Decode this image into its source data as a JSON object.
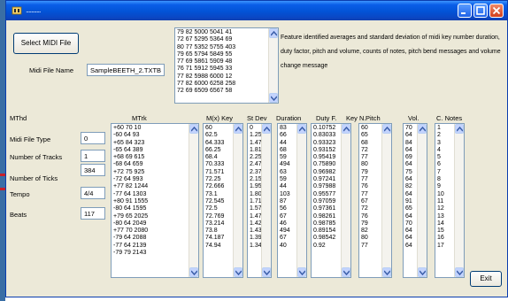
{
  "window": {
    "title": "...........",
    "accent": "#0253d6"
  },
  "buttons": {
    "select_midi": "Select MIDI File",
    "exit": "Exit"
  },
  "file_name": {
    "label": "Midi File Name",
    "value": "SampleBEETH_2.TXTB"
  },
  "preview_rows": [
    "79 82 5000 5041 41",
    "72 67 5295 5364 69",
    "80 77 5352 5755 403",
    "79 65 5794 5849 55",
    "77 69 5861 5909 48",
    "76 71 5912 5945 33",
    "77 82 5988 6000 12",
    "77 82 6000 6258 258",
    "72 69 6509 6567 58"
  ],
  "description": "Feature identified averages and standard deviation of midi key number duration, duty factor, pitch and volume, counts of notes, pitch bend messages and volume change message",
  "mthd": {
    "heading": "MThd",
    "fields": [
      {
        "label": "Midi File Type",
        "value": "0"
      },
      {
        "label": "Number of Tracks",
        "value": "1"
      },
      {
        "label": "Number of Ticks",
        "value": "384"
      },
      {
        "label": "Tempo",
        "value": "4/4"
      },
      {
        "label": "Beats",
        "value": "117"
      }
    ]
  },
  "mtrk": {
    "heading": "MTrk",
    "rows": [
      "+60 70 10",
      "-60 64 93",
      "+65 84 323",
      "-65 64 389",
      "+68 69 615",
      "-68 64 659",
      "+72 75 925",
      "-72 64 993",
      "+77 82 1244",
      "-77 64 1303",
      "+80 91 1555",
      "-80 64 1595",
      "+79 65 2025",
      "-80 64 2049",
      "+77 70 2080",
      "-79 64 2088",
      "-77 64 2139",
      "-79 79 2143"
    ]
  },
  "columns": {
    "headers": {
      "mkey": "M(x) Key",
      "stdev": "St Dev",
      "duration": "Duration",
      "duty": "Duty F.",
      "keyn": "Key N.",
      "pitch": "Pitch",
      "vol": "Vol.",
      "cnotes": "C. Notes"
    },
    "mkey": [
      "60",
      "62.5",
      "64.333",
      "66.25",
      "68.4",
      "70.333",
      "71.571",
      "72.25",
      "72.666",
      "73.1",
      "72.545",
      "72.5",
      "72.769",
      "73.214",
      "73.8",
      "74.187",
      "74.94"
    ],
    "stdev": [
      "0",
      "1.25",
      "1.475",
      "1.815",
      "2.251",
      "2.472",
      "2.370",
      "2.157",
      "1.953",
      "1.800",
      "1.712",
      "1.570",
      "1.470",
      "1.427",
      "1.435",
      "1.397",
      "1.34"
    ],
    "duration": [
      "83",
      "66",
      "44",
      "68",
      "59",
      "494",
      "63",
      "59",
      "44",
      "103",
      "87",
      "56",
      "67",
      "46",
      "494",
      "67",
      "40"
    ],
    "duty": [
      "0.10752",
      "0.83033",
      "0.93323",
      "0.93152",
      "0.95419",
      "0.75890",
      "0.96982",
      "0.97241",
      "0.97988",
      "0.95577",
      "0.97059",
      "0.97361",
      "0.98261",
      "0.98785",
      "0.89154",
      "0.98542",
      "0.92"
    ],
    "keyn": [
      "",
      "",
      "",
      "",
      "",
      "",
      "",
      "",
      "",
      "",
      "",
      "",
      "",
      "",
      "",
      "",
      ""
    ],
    "pitch": [
      "60",
      "65",
      "68",
      "72",
      "77",
      "80",
      "79",
      "77",
      "76",
      "77",
      "67",
      "72",
      "76",
      "79",
      "82",
      "80",
      "77"
    ],
    "vol": [
      "70",
      "64",
      "84",
      "64",
      "69",
      "64",
      "75",
      "64",
      "82",
      "64",
      "91",
      "65",
      "64",
      "70",
      "64",
      "64",
      "64"
    ],
    "cnotes": [
      "1",
      "2",
      "3",
      "4",
      "5",
      "6",
      "7",
      "8",
      "9",
      "10",
      "11",
      "12",
      "13",
      "14",
      "15",
      "16",
      "17"
    ]
  }
}
